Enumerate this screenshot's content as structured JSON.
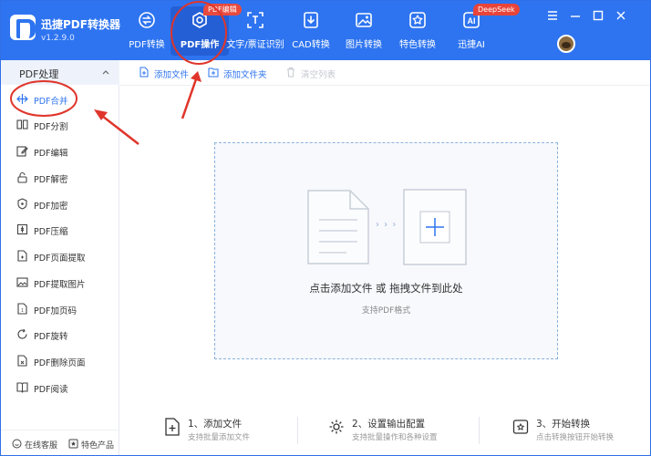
{
  "app": {
    "name": "迅捷PDF转换器",
    "version": "v1.2.9.0"
  },
  "nav": [
    {
      "label": "PDF转换",
      "icon": "convert-icon"
    },
    {
      "label": "PDF操作",
      "icon": "pdf-operate-icon",
      "badge": "PDF编辑"
    },
    {
      "label": "文字/票证识别",
      "icon": "ocr-icon"
    },
    {
      "label": "CAD转换",
      "icon": "cad-icon"
    },
    {
      "label": "图片转换",
      "icon": "image-icon"
    },
    {
      "label": "特色转换",
      "icon": "star-icon"
    },
    {
      "label": "迅捷AI",
      "icon": "ai-icon",
      "badge": "DeepSeek"
    }
  ],
  "sidebar": {
    "title": "PDF处理",
    "items": [
      {
        "label": "PDF合并",
        "icon": "merge-icon"
      },
      {
        "label": "PDF分割",
        "icon": "split-icon"
      },
      {
        "label": "PDF编辑",
        "icon": "edit-icon"
      },
      {
        "label": "PDF解密",
        "icon": "unlock-icon"
      },
      {
        "label": "PDF加密",
        "icon": "shield-icon"
      },
      {
        "label": "PDF压缩",
        "icon": "compress-icon"
      },
      {
        "label": "PDF页面提取",
        "icon": "page-extract-icon"
      },
      {
        "label": "PDF提取图片",
        "icon": "image-extract-icon"
      },
      {
        "label": "PDF加页码",
        "icon": "page-number-icon"
      },
      {
        "label": "PDF旋转",
        "icon": "rotate-icon"
      },
      {
        "label": "PDF删除页面",
        "icon": "delete-page-icon"
      },
      {
        "label": "PDF阅读",
        "icon": "book-icon"
      }
    ],
    "footer": {
      "support": "在线客服",
      "products": "特色产品"
    }
  },
  "toolbar": {
    "add_file": "添加文件",
    "add_folder": "添加文件夹",
    "clear_list": "清空列表"
  },
  "dropzone": {
    "main_text": "点击添加文件 或 拖拽文件到此处",
    "sub_text": "支持PDF格式",
    "arrows": "› › ›"
  },
  "steps": [
    {
      "title": "1、添加文件",
      "desc": "支持批量添加文件"
    },
    {
      "title": "2、设置输出配置",
      "desc": "支持批量操作和各种设置"
    },
    {
      "title": "3、开始转换",
      "desc": "点击转换按钮开始转换"
    }
  ],
  "colors": {
    "brand": "#2e74f0",
    "annotation": "#e0352b"
  }
}
